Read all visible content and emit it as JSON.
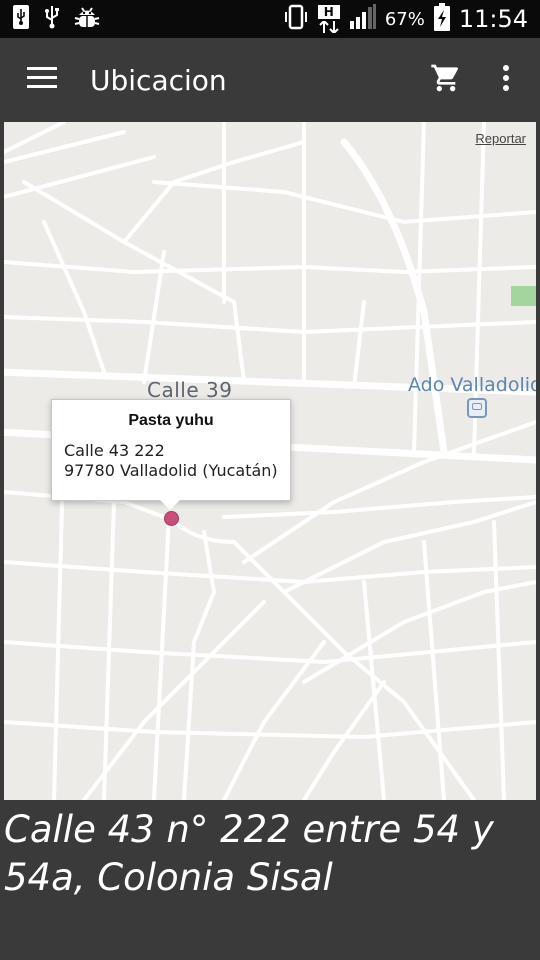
{
  "status_bar": {
    "network_badge": "H",
    "battery_percent": "67%",
    "time": "11:54",
    "icons": [
      "usb-icon",
      "usb-icon",
      "android-debug-icon",
      "vibrate-icon",
      "hspa-data-icon",
      "signal-icon",
      "battery-charging-icon"
    ]
  },
  "app_bar": {
    "title": "Ubicacion",
    "icons": [
      "menu-icon",
      "shopping-cart-icon",
      "more-vert-icon"
    ]
  },
  "map": {
    "report_link": "Reportar",
    "street_label": "Calle 39",
    "poi_label": "Ado Valladolid",
    "info_window": {
      "title": "Pasta yuhu",
      "line1": "Calle 43 222",
      "line2": "97780 Valladolid (Yucatán)"
    },
    "colors": {
      "background": "#ecebe7",
      "roads": "#ffffff",
      "marker": "#c94f7a",
      "park": "#9fd69a"
    }
  },
  "address_text": "Calle 43 n° 222 entre 54 y 54a, Colonia Sisal",
  "colors": {
    "app_bar": "#3a3a3a",
    "status_bar": "#0a0a0a"
  }
}
